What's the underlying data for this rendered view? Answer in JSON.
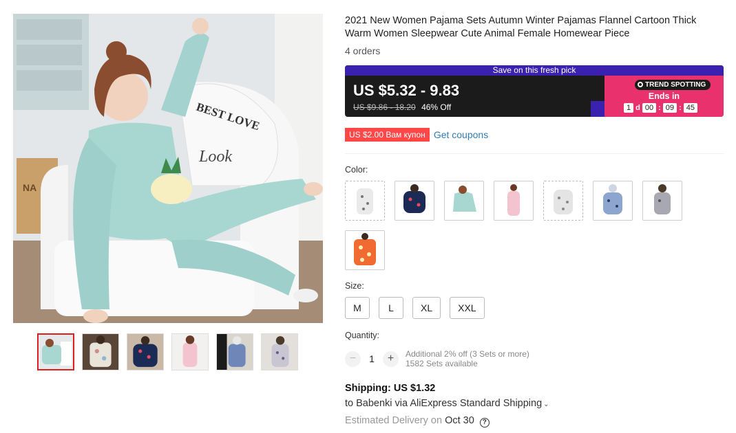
{
  "product": {
    "title": "2021 New Women Pajama Sets Autumn Winter Pajamas Flannel Cartoon Thick Warm Women Sleepwear Cute Animal Female Homewear Piece",
    "orders": "4 orders"
  },
  "gallery": {
    "main_image": "woman-in-mint-flannel-pajamas-on-armchair",
    "chair_text_1": "BEST LOVE",
    "chair_text_2": "Look",
    "box_text": "NA",
    "thumbnails": [
      "mint-pajama",
      "floral-pajama",
      "navy-heart-pajama",
      "pink-pajama",
      "navy-print-pajama",
      "white-print-pajama"
    ],
    "active_thumb": 0
  },
  "price": {
    "banner": "Save on this fresh pick",
    "range": "US $5.32 - 9.83",
    "original": "US $9.86 - 18.20",
    "discount": "46% Off",
    "trend_label": "TREND SPOTTING",
    "ends_in": "Ends in",
    "countdown": {
      "days": "1",
      "day_label": "d",
      "hours": "00",
      "sep1": ":",
      "minutes": "09",
      "sep2": ":",
      "seconds": "45"
    }
  },
  "coupon": {
    "badge": "US $2.00 Вам купон",
    "link": "Get coupons"
  },
  "color": {
    "label": "Color:",
    "swatches": [
      "white-star",
      "navy-heart",
      "mint",
      "pink",
      "white-print",
      "blue-print",
      "grey-cat",
      "orange-print"
    ]
  },
  "size": {
    "label": "Size:",
    "options": [
      "M",
      "L",
      "XL",
      "XXL"
    ]
  },
  "quantity": {
    "label": "Quantity:",
    "minus": "−",
    "value": "1",
    "plus": "+",
    "note_line1": "Additional 2% off (3 Sets or more)",
    "note_line2": "1582 Sets available"
  },
  "shipping": {
    "cost": "Shipping: US $1.32",
    "method": "to Babenki via AliExpress Standard Shipping",
    "chevron": "⌄",
    "est_label": "Estimated Delivery on",
    "est_date": "Oct 30",
    "help": "?"
  },
  "colors": {
    "accent": "#3a21b0",
    "promo": "#e8316d",
    "coupon": "#ff4747",
    "link": "#2e7db7"
  }
}
